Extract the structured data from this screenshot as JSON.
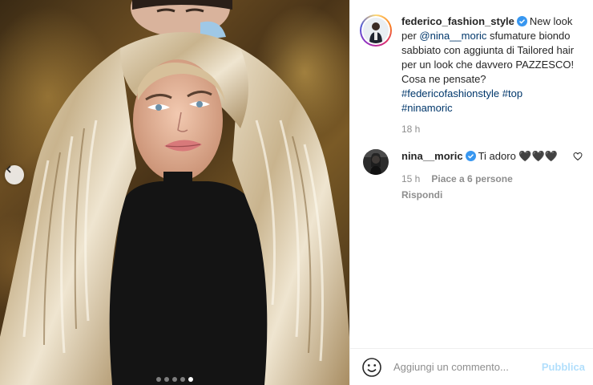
{
  "photo": {
    "alt_icon": "post-photo",
    "nav_prev_icon": "chevron-left-icon",
    "carousel": {
      "count": 5,
      "active_index": 4
    }
  },
  "caption": {
    "username": "federico_fashion_style",
    "verified_icon": "verified-badge-icon",
    "text_1": "New look per ",
    "mention": "@nina__moric",
    "text_2": " sfumature biondo sabbiato con aggiunta di Tailored hair per un look che davvero PAZZESCO! Cosa ne pensate?",
    "hashtags": [
      "#federicofashionstyle",
      "#top",
      "#ninamoric"
    ],
    "time": "18 h"
  },
  "comment": {
    "username": "nina__moric",
    "verified_icon": "verified-badge-icon",
    "text": "Ti adoro 🖤🖤🖤",
    "time": "15 h",
    "likes": "Piace a 6 persone",
    "reply_label": "Rispondi",
    "like_icon": "heart-outline-icon"
  },
  "add_comment": {
    "emoji_icon": "smiley-icon",
    "placeholder": "Aggiungi un commento...",
    "publish_label": "Pubblica"
  },
  "colors": {
    "link": "#00376b",
    "muted": "#8e8e8e",
    "verified": "#3897f0",
    "publish_disabled": "#b2dffc"
  }
}
